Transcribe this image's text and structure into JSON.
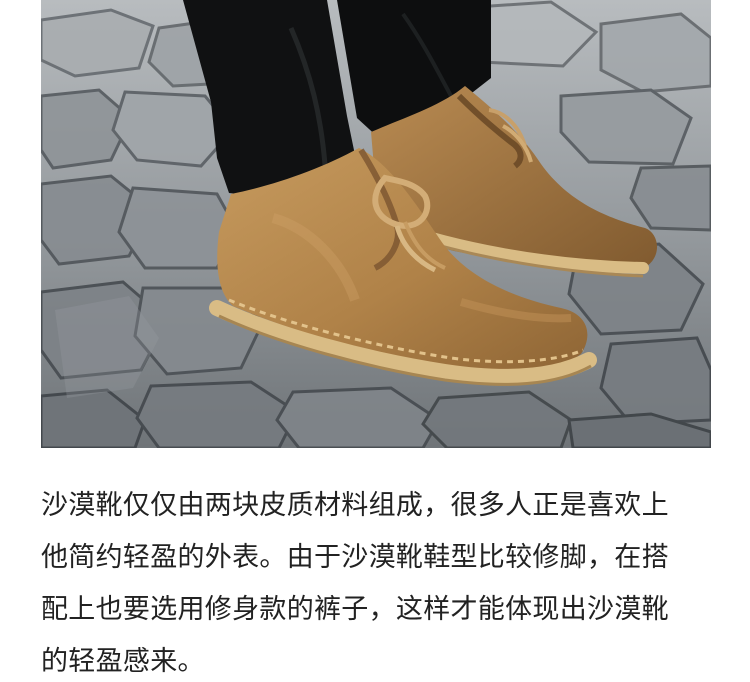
{
  "caption": {
    "lines": [
      "沙漠靴仅仅由两块皮质材料组成，很多人正是喜欢上",
      "他简约轻盈的外表。由于沙漠靴鞋型比较修脚，在搭",
      "配上也要选用修身款的裤子，这样才能体现出沙漠靴",
      "的轻盈感来。"
    ]
  },
  "image": {
    "subject": "desert-boots-on-cobblestone-photo",
    "colors": {
      "suede": "#b8894d",
      "suede_shadow": "#8e6535",
      "sole": "#d8b981",
      "jeans": "#111111",
      "stone": "#8f9397"
    }
  }
}
